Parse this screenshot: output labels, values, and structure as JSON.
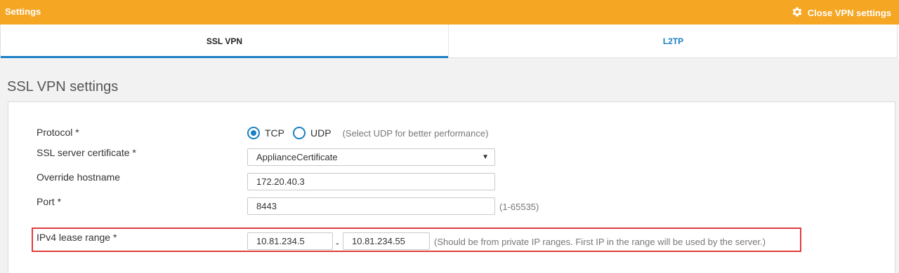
{
  "header": {
    "title": "Settings",
    "close_label": "Close VPN settings",
    "close_icon": "gear-icon",
    "color": "#f5a623"
  },
  "tabs": [
    {
      "label": "SSL VPN",
      "active": true
    },
    {
      "label": "L2TP",
      "active": false
    }
  ],
  "section": {
    "title": "SSL VPN settings"
  },
  "form": {
    "protocol": {
      "label": "Protocol *",
      "options": [
        {
          "label": "TCP",
          "selected": true
        },
        {
          "label": "UDP",
          "selected": false
        }
      ],
      "hint": "(Select UDP for better performance)"
    },
    "certificate": {
      "label": "SSL server certificate *",
      "value": "ApplianceCertificate"
    },
    "hostname": {
      "label": "Override hostname",
      "value": "172.20.40.3"
    },
    "port": {
      "label": "Port *",
      "value": "8443",
      "hint": "(1-65535)"
    },
    "lease_range": {
      "label": "IPv4 lease range *",
      "start": "10.81.234.5",
      "separator": "-",
      "end": "10.81.234.55",
      "hint": "(Should be from private IP ranges. First IP in the range will be used by the server.)"
    }
  },
  "colors": {
    "accent": "#1a7fc4",
    "highlight": "#e03c3c"
  }
}
